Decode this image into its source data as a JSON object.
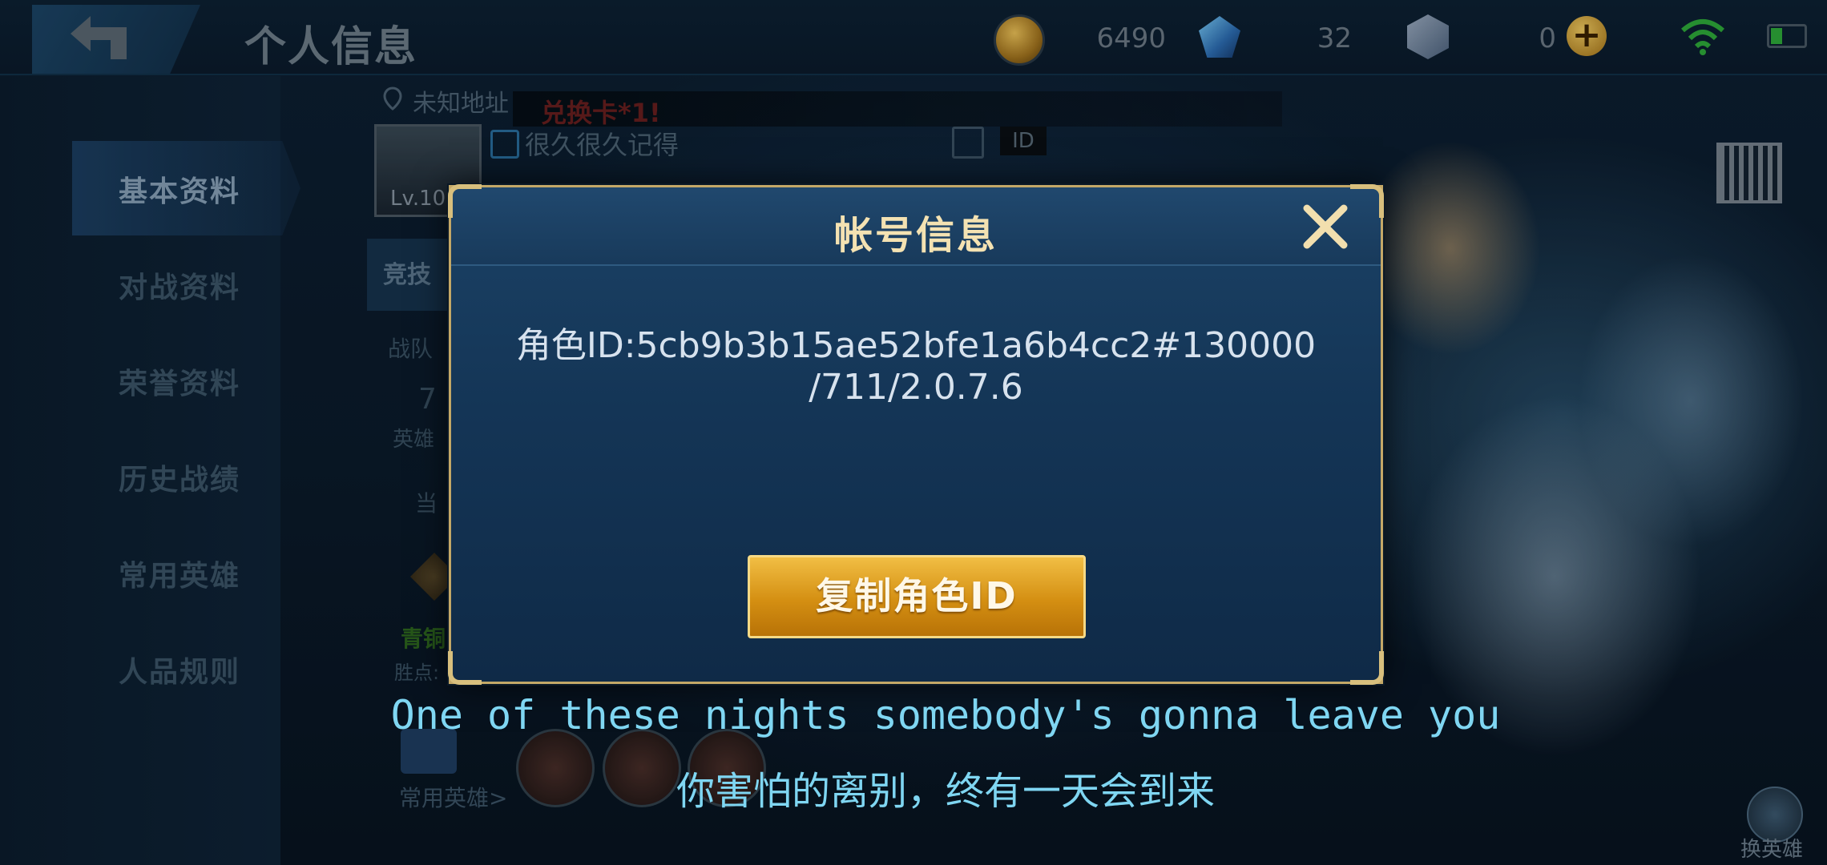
{
  "topbar": {
    "title": "个人信息",
    "gold": "6490",
    "diamond": "32",
    "voucher": "0",
    "plus_label": "+"
  },
  "sidebar": {
    "items": [
      {
        "label": "基本资料",
        "active": true
      },
      {
        "label": "对战资料"
      },
      {
        "label": "荣誉资料"
      },
      {
        "label": "历史战绩"
      },
      {
        "label": "常用英雄"
      },
      {
        "label": "人品规则"
      }
    ]
  },
  "profile": {
    "location": "未知地址",
    "marquee": "兑换卡*1!",
    "level": "Lv.10",
    "nickname": "很久很久记得",
    "id_tag": "ID",
    "sub_tab": "竞技",
    "team_label": "战队",
    "hero_count": "7",
    "hero_count_label": "英雄",
    "season_label": "当",
    "rank_name": "青铜",
    "points_label": "胜点:",
    "frequent_heroes_label": "常用英雄>",
    "swap_hero_label": "换英雄"
  },
  "modal": {
    "title": "帐号信息",
    "role_id_text": "角色ID:5cb9b3b15ae52bfe1a6b4cc2#130000\n/711/2.0.7.6",
    "copy_button_label": "复制角色ID"
  },
  "subtitles": {
    "english": "One of these nights somebody's gonna leave you",
    "chinese": "你害怕的离别，终有一天会到来"
  },
  "colors": {
    "modal_border": "#c4a867",
    "copy_button": "#d48f12",
    "subtitle": "#7fd6f2",
    "title_text": "#f4e2b2"
  }
}
